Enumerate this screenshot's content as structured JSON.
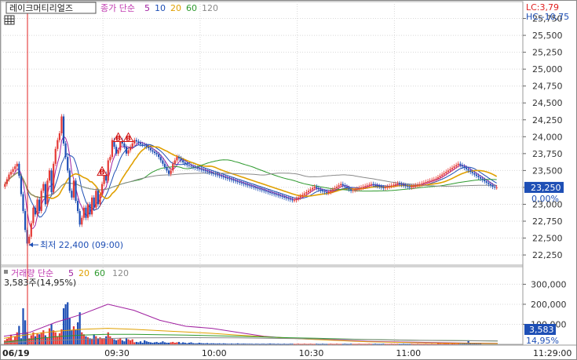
{
  "chart_data": {
    "type": "candlestick",
    "title_box": "레이크머티리얼즈",
    "price_legend": {
      "label": "종가 단순",
      "periods": [
        "5",
        "10",
        "20",
        "60",
        "120"
      ]
    },
    "volume_legend": {
      "label": "거래량 단순",
      "periods": [
        "5",
        "20",
        "60",
        "120"
      ]
    },
    "lc_label": "LC:3,79",
    "hc_label": "HC:-10,75",
    "price_axis": {
      "ylim": [
        22100,
        26000
      ],
      "ticks": [
        22250,
        22500,
        22750,
        23000,
        23250,
        23500,
        23750,
        24000,
        24250,
        24500,
        24750,
        25000,
        25250,
        25500,
        25750
      ],
      "tick_labels": [
        "22,250",
        "22,500",
        "22,750",
        "23,000",
        "23,250",
        "23,500",
        "23,750",
        "24,000",
        "24,250",
        "24,500",
        "24,750",
        "25,000",
        "25,250",
        "25,500",
        "25,750"
      ]
    },
    "current_price": 23250,
    "current_price_label": "23,250",
    "change_label": "0,00%",
    "low_annotation": {
      "text": "최저 22,400 (09:00)",
      "price": 22400
    },
    "volume_axis": {
      "ylim": [
        0,
        380000
      ],
      "ticks": [
        100000,
        200000,
        300000
      ],
      "tick_labels": [
        "100,000",
        "200,000",
        "300,000"
      ]
    },
    "volume_info": "3,583주(14,95%)",
    "volume_badge": {
      "value": 3583,
      "value_label": "3,583",
      "pct_label": "14,95%"
    },
    "x_labels": [
      "06/19",
      "09:30",
      "10:00",
      "10:30",
      "11:00",
      "11:29:00"
    ],
    "buy_signal_label": "B",
    "buy_signal_indices": [
      48,
      56,
      61
    ],
    "volume_colors": {
      "up": "#e53935",
      "down": "#1e4fb5"
    },
    "close_series": [
      23300,
      23370,
      23440,
      23480,
      23520,
      23560,
      23600,
      23420,
      23150,
      22900,
      22620,
      22420,
      22520,
      22720,
      22950,
      22850,
      23070,
      22900,
      23200,
      23300,
      23000,
      23350,
      23500,
      23180,
      23600,
      23820,
      23950,
      24050,
      24300,
      23900,
      23700,
      23500,
      23200,
      23100,
      23350,
      23050,
      22900,
      22700,
      22800,
      22950,
      22800,
      23000,
      22850,
      23100,
      22950,
      23200,
      23000,
      23150,
      23300,
      23450,
      23350,
      23650,
      23700,
      23950,
      23850,
      23750,
      23800,
      23950,
      23900,
      23850,
      23750,
      23800,
      23850,
      23900,
      23950,
      23930,
      23910,
      23890,
      23880,
      23870,
      23850,
      23830,
      23800,
      23780,
      23760,
      23740,
      23700,
      23650,
      23600,
      23550,
      23500,
      23450,
      23500,
      23600,
      23650,
      23700,
      23680,
      23650,
      23620,
      23600,
      23580,
      23570,
      23560,
      23550,
      23540,
      23530,
      23520,
      23510,
      23500,
      23490,
      23480,
      23470,
      23460,
      23450,
      23440,
      23430,
      23420,
      23410,
      23400,
      23390,
      23380,
      23370,
      23360,
      23350,
      23340,
      23330,
      23320,
      23310,
      23300,
      23290,
      23280,
      23270,
      23260,
      23250,
      23240,
      23230,
      23220,
      23210,
      23200,
      23190,
      23180,
      23170,
      23160,
      23150,
      23140,
      23130,
      23120,
      23110,
      23100,
      23090,
      23080,
      23070,
      23060,
      23060,
      23080,
      23100,
      23120,
      23140,
      23160,
      23180,
      23200,
      23220,
      23240,
      23260,
      23240,
      23220,
      23200,
      23190,
      23180,
      23170,
      23180,
      23200,
      23220,
      23240,
      23260,
      23280,
      23300,
      23280,
      23260,
      23240,
      23220,
      23200,
      23210,
      23220,
      23230,
      23240,
      23250,
      23260,
      23270,
      23280,
      23290,
      23300,
      23290,
      23280,
      23270,
      23260,
      23250,
      23240,
      23250,
      23260,
      23270,
      23280,
      23290,
      23300,
      23310,
      23300,
      23290,
      23280,
      23270,
      23260,
      23250,
      23260,
      23270,
      23280,
      23290,
      23300,
      23310,
      23320,
      23330,
      23340,
      23350,
      23360,
      23370,
      23380,
      23400,
      23420,
      23440,
      23460,
      23480,
      23500,
      23520,
      23540,
      23560,
      23580,
      23600,
      23580,
      23560,
      23540,
      23520,
      23500,
      23480,
      23460,
      23440,
      23420,
      23400,
      23380,
      23360,
      23340,
      23320,
      23300,
      23280,
      23260,
      23250,
      23250
    ],
    "volume_series": [
      20000,
      28000,
      35000,
      48000,
      22000,
      40000,
      60000,
      92000,
      30000,
      180000,
      120000,
      60000,
      30000,
      45000,
      60000,
      40000,
      55000,
      50000,
      60000,
      70000,
      45000,
      35000,
      80000,
      100000,
      70000,
      60000,
      40000,
      55000,
      75000,
      180000,
      200000,
      210000,
      130000,
      70000,
      90000,
      75000,
      110000,
      160000,
      60000,
      50000,
      40000,
      35000,
      30000,
      25000,
      50000,
      40000,
      30000,
      35000,
      30000,
      30000,
      40000,
      60000,
      40000,
      30000,
      25000,
      20000,
      25000,
      30000,
      20000,
      15000,
      30000,
      25000,
      20000,
      25000,
      10000,
      12000,
      10000,
      15000,
      8000,
      20000,
      15000,
      12000,
      10000,
      8000,
      10000,
      12000,
      8000,
      10000,
      15000,
      10000,
      8000,
      8000,
      10000,
      12000,
      8000,
      10000,
      12000,
      6000,
      10000,
      8000,
      5000,
      8000,
      10000,
      6000,
      5000,
      5000,
      8000,
      6000,
      5000,
      5000,
      6000,
      4000,
      5000,
      5000,
      4000,
      4000,
      5000,
      3000,
      5000,
      4000,
      3000,
      3000,
      4000,
      3000,
      3000,
      5000,
      3000,
      3000,
      4000,
      3000,
      3000,
      3000,
      3000,
      2000,
      3000,
      3000,
      2000,
      3000,
      3000,
      2000,
      3000,
      4000,
      3000,
      3000,
      2000,
      3000,
      2000,
      2000,
      3000,
      2000,
      2000,
      3000,
      3000,
      2000,
      2000,
      3000,
      2000,
      2000,
      3000,
      2000,
      2000,
      3000,
      2000,
      2000,
      3000,
      2000,
      2000,
      3000,
      2000,
      2000,
      2000,
      3000,
      2000,
      2000,
      3000,
      2000,
      2000,
      2000,
      3000,
      2000,
      2000,
      3000,
      2000,
      2000,
      2000,
      3000,
      2000,
      2000,
      2000,
      2000,
      3000,
      2000,
      2000,
      3000,
      2000,
      2000,
      2000,
      3000,
      2000,
      2000,
      2000,
      3000,
      2000,
      2000,
      3000,
      2000,
      2000,
      3000,
      2000,
      2000,
      2000,
      3000,
      2000,
      2000,
      3000,
      2000,
      2000,
      2000,
      3000,
      2000,
      2000,
      3000,
      2000,
      2000,
      8000,
      5000,
      3000,
      4000,
      6000,
      4000,
      3000,
      5000,
      4000,
      3000,
      4000,
      3000,
      3000,
      6000,
      3000,
      20000,
      5000,
      3000,
      4000,
      3000,
      3000,
      3583
    ],
    "volume_ma_series": [
      {
        "name": "5",
        "color": "#a020a0",
        "values": [
          40000,
          60000,
          110000,
          150000,
          200000,
          170000,
          120000,
          90000,
          80000,
          60000,
          40000,
          30000,
          25000,
          20000,
          15000,
          12000,
          10000,
          8000,
          6000,
          5000
        ]
      },
      {
        "name": "20",
        "color": "#e0a000",
        "values": [
          30000,
          50000,
          65000,
          75000,
          80000,
          75000,
          68000,
          62000,
          55000,
          46000,
          38000,
          30000,
          24000,
          18000,
          13000,
          10000,
          8000,
          6000,
          5000,
          4000
        ]
      },
      {
        "name": "60",
        "color": "#2e9a2e",
        "values": [
          10000,
          25000,
          38000,
          46000,
          50000,
          50000,
          48000,
          46000,
          43000,
          40000,
          37000,
          33000,
          30000,
          27000,
          24000,
          22000,
          20000,
          19000,
          18000,
          17000
        ]
      },
      {
        "name": "120",
        "color": "#8a8a8a",
        "values": [
          8000,
          14000,
          20000,
          25000,
          29000,
          32000,
          33000,
          33500,
          33000,
          32000,
          30500,
          29000,
          27000,
          25000,
          23000,
          21000,
          19500,
          18500,
          17500,
          16500
        ]
      }
    ],
    "ma_series": [
      {
        "name": "5",
        "color": "#a020a0"
      },
      {
        "name": "10",
        "color": "#1e4fb5"
      },
      {
        "name": "20",
        "color": "#e0a000"
      },
      {
        "name": "60",
        "color": "#2e9a2e"
      },
      {
        "name": "120",
        "color": "#8a8a8a"
      }
    ]
  }
}
